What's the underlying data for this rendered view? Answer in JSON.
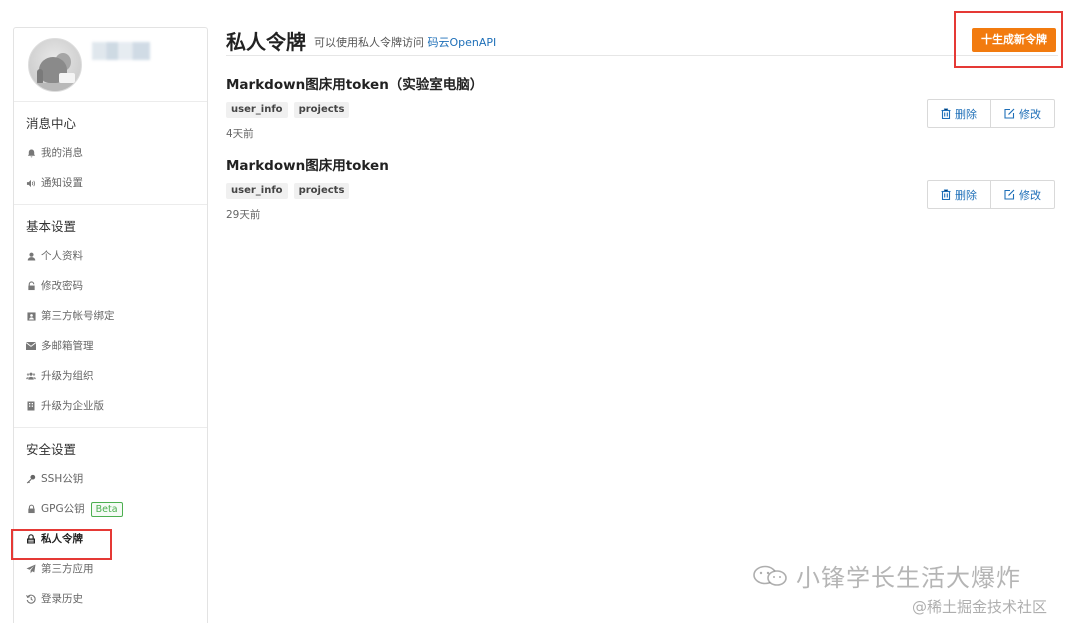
{
  "sidebar": {
    "sections": [
      {
        "title": "消息中心",
        "items": [
          {
            "label": "我的消息",
            "icon": "bell-icon"
          },
          {
            "label": "通知设置",
            "icon": "speaker-icon"
          }
        ]
      },
      {
        "title": "基本设置",
        "items": [
          {
            "label": "个人资料",
            "icon": "user-icon"
          },
          {
            "label": "修改密码",
            "icon": "unlock-icon"
          },
          {
            "label": "第三方帐号绑定",
            "icon": "id-card-icon"
          },
          {
            "label": "多邮箱管理",
            "icon": "envelope-icon"
          },
          {
            "label": "升级为组织",
            "icon": "users-icon"
          },
          {
            "label": "升级为企业版",
            "icon": "building-icon"
          }
        ]
      },
      {
        "title": "安全设置",
        "items": [
          {
            "label": "SSH公钥",
            "icon": "key-icon"
          },
          {
            "label": "GPG公钥",
            "icon": "lock-icon",
            "badge": "Beta"
          },
          {
            "label": "私人令牌",
            "icon": "token-icon",
            "active": true
          },
          {
            "label": "第三方应用",
            "icon": "plane-icon"
          },
          {
            "label": "登录历史",
            "icon": "history-icon"
          }
        ]
      }
    ]
  },
  "header": {
    "title": "私人令牌",
    "subtitle": "可以使用私人令牌访问",
    "subtitle_link": "码云OpenAPI",
    "generate_button": "十生成新令牌"
  },
  "tokens": [
    {
      "name": "Markdown图床用token（实验室电脑）",
      "scopes": [
        "user_info",
        "projects"
      ],
      "time": "4天前",
      "delete_label": "删除",
      "edit_label": "修改"
    },
    {
      "name": "Markdown图床用token",
      "scopes": [
        "user_info",
        "projects"
      ],
      "time": "29天前",
      "delete_label": "删除",
      "edit_label": "修改"
    }
  ],
  "watermark": {
    "line1": "小锋学长生活大爆炸",
    "line2": "@稀土掘金技术社区"
  },
  "colors": {
    "primary_orange": "#f27b0f",
    "link_blue": "#1e6fb8",
    "highlight_red": "#e53935",
    "beta_green": "#4caf50"
  }
}
